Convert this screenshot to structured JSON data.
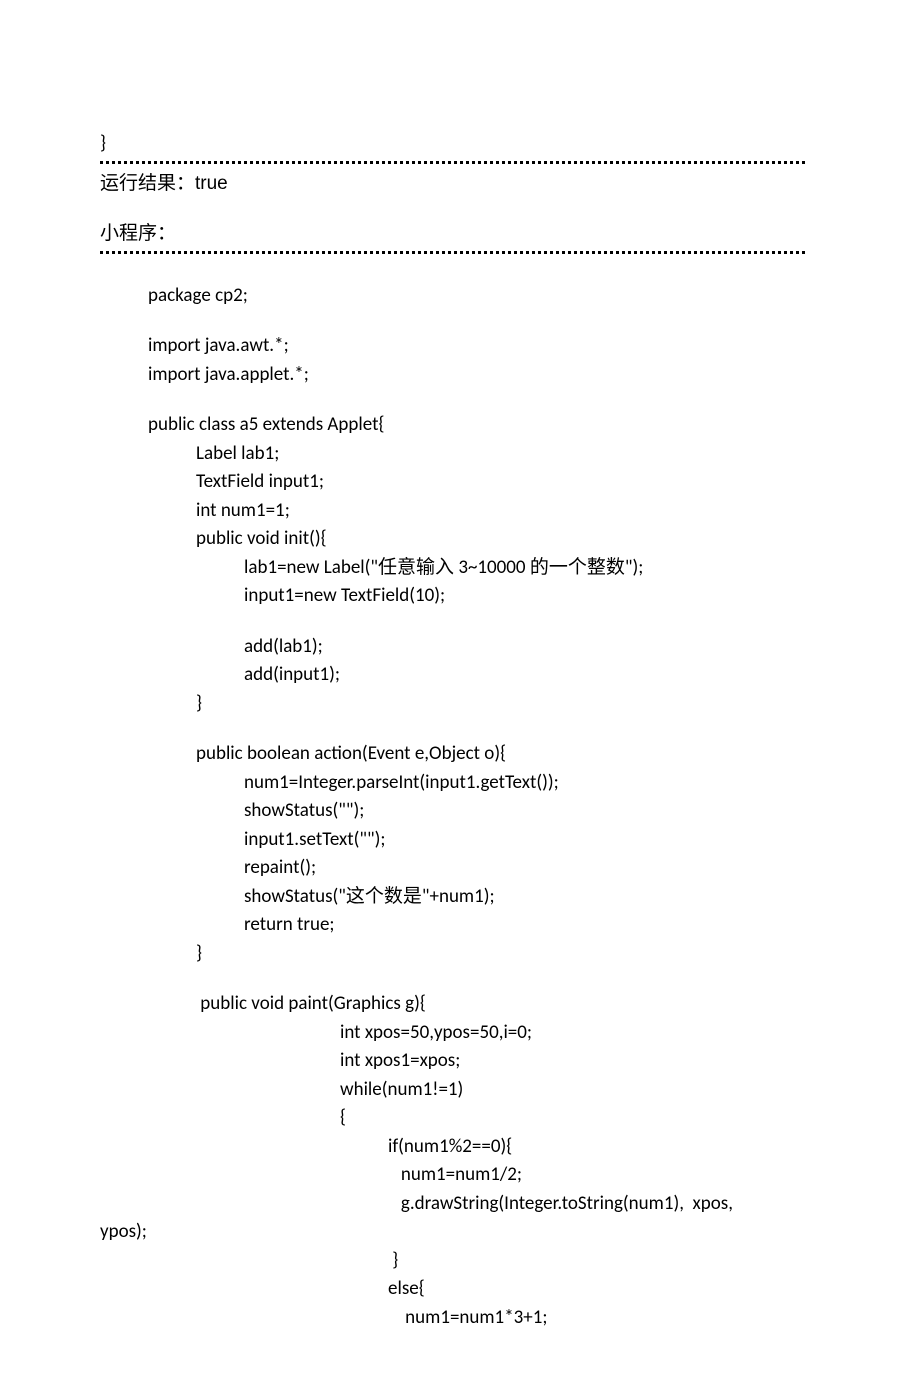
{
  "lines": {
    "l1": "}",
    "l2": "运行结果：true",
    "l3": "小程序：",
    "c1": "package cp2;",
    "c2": "import java.awt.*;",
    "c3": "import java.applet.*;",
    "c4": "public class a5 extends Applet{",
    "c5": "Label lab1;",
    "c6": "TextField input1;",
    "c7": "int num1=1;",
    "c8": "public void init(){",
    "c9": "lab1=new Label(\"任意输入 3~10000 的一个整数\");",
    "c10": "input1=new TextField(10);",
    "c11": "add(lab1);",
    "c12": "add(input1);",
    "c13": "}",
    "c14": "public boolean action(Event e,Object o){",
    "c15": "num1=Integer.parseInt(input1.getText());",
    "c16": "showStatus(\"\");",
    "c17": "input1.setText(\"\");",
    "c18": "repaint();",
    "c19": "showStatus(\"这个数是\"+num1);",
    "c20": "return true;",
    "c21": "}",
    "c22": " public void paint(Graphics g){",
    "c23": "int xpos=50,ypos=50,i=0;",
    "c24": "int xpos1=xpos;",
    "c25": "while(num1!=1)",
    "c26": "{",
    "c27": "if(num1%2==0){",
    "c28": "   num1=num1/2;",
    "c29a": "   g.drawString(Integer.toString(num1),  xpos,",
    "c29b": "ypos);",
    "c30": " }",
    "c31": "else{",
    "c32": "    num1=num1*3+1;"
  }
}
